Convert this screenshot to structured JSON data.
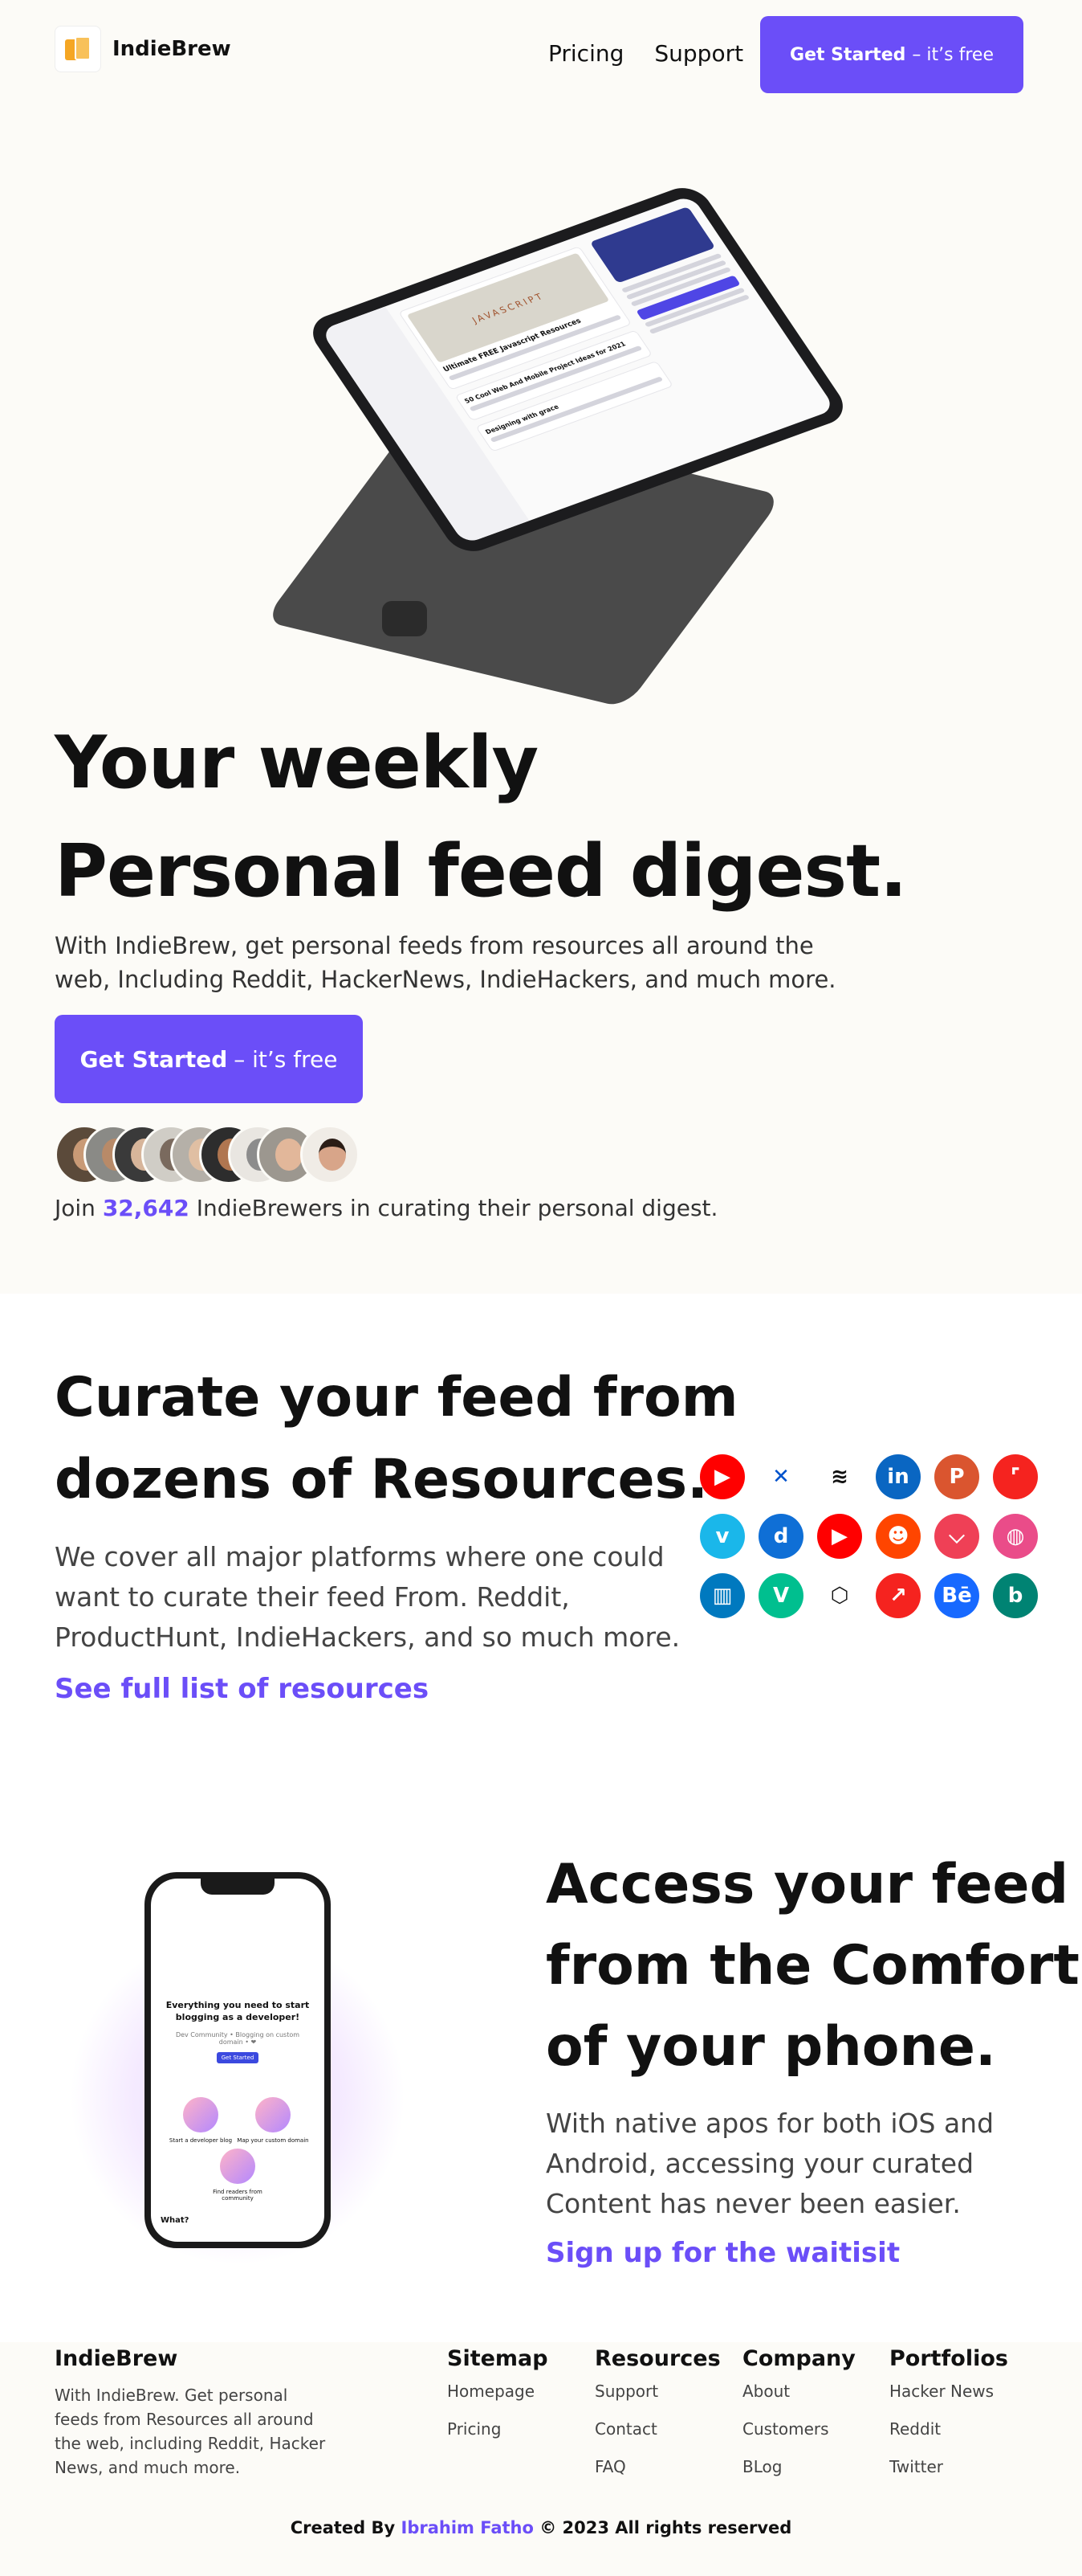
{
  "brand": {
    "name": "IndieBrew"
  },
  "nav": {
    "links": [
      "Pricing",
      "Support"
    ],
    "cta_bold": "Get Started",
    "cta_rest": "– it’s free"
  },
  "hero": {
    "title_line1": "Your weekly",
    "title_line2": "Personal feed digest.",
    "subtitle": "With IndieBrew, get personal feeds from resources all around the web, Including Reddit, HackerNews, IndieHackers, and much more.",
    "cta_bold": "Get Started",
    "cta_rest": "– it’s free",
    "join_prefix": "Join ",
    "join_count": "32,642",
    "join_suffix": " IndieBrewers in curating their personal digest.",
    "tablet_screen": {
      "post_1": "Ultimate FREE Javascript Resources",
      "post_2": "50 Cool Web And Mobile Project Ideas for 2021",
      "post_3": "Designing with grace",
      "cover_text": "JAVASCRIPT"
    }
  },
  "curate": {
    "title_line1": "Curate your feed from",
    "title_line2": "dozens of Resources.",
    "description": "We cover all major platforms where one could want to curate their feed From. Reddit, ProductHunt, IndieHackers, and so much more.",
    "link": "See full list of resources",
    "resources": [
      {
        "name": "youtube-icon",
        "color": "#ff0000",
        "glyph": "▶"
      },
      {
        "name": "confluence-icon",
        "color": "#ffffff",
        "glyph": "✕"
      },
      {
        "name": "buffer-icon",
        "color": "#ffffff",
        "glyph": "≋"
      },
      {
        "name": "linkedin-icon",
        "color": "#0a66c2",
        "glyph": "in"
      },
      {
        "name": "producthunt-icon",
        "color": "#da552f",
        "glyph": "P"
      },
      {
        "name": "screenshot-icon",
        "color": "#f5231f",
        "glyph": "⌜"
      },
      {
        "name": "vimeo-icon",
        "color": "#1ab7ea",
        "glyph": "v"
      },
      {
        "name": "dailydev-icon",
        "color": "#0f6fd6",
        "glyph": "d"
      },
      {
        "name": "youtube-icon-2",
        "color": "#ff0000",
        "glyph": "▶"
      },
      {
        "name": "reddit-icon",
        "color": "#ff4500",
        "glyph": "☻"
      },
      {
        "name": "pocket-icon",
        "color": "#ef4056",
        "glyph": "⌵"
      },
      {
        "name": "dribbble-icon",
        "color": "#ea4c89",
        "glyph": "◍"
      },
      {
        "name": "trello-icon",
        "color": "#0079bf",
        "glyph": "▥"
      },
      {
        "name": "vine-icon",
        "color": "#00bf8f",
        "glyph": "V"
      },
      {
        "name": "codepen-icon",
        "color": "#ffffff",
        "glyph": "⬡"
      },
      {
        "name": "trending-icon",
        "color": "#f5231f",
        "glyph": "↗"
      },
      {
        "name": "behance-icon",
        "color": "#1769ff",
        "glyph": "Bē"
      },
      {
        "name": "bing-icon",
        "color": "#008373",
        "glyph": "b"
      }
    ]
  },
  "access": {
    "title_line1": "Access your feed",
    "title_line2": "from the Comfort",
    "title_line3": "of your phone.",
    "description": "With native apos for both iOS and Android, accessing your curated Content has never been easier.",
    "link": "Sign up for the waitisit",
    "phone_screen": {
      "heading": "Everything you need to start blogging as a developer!",
      "sub": "Dev Community • Blogging on custom domain • ❤",
      "button": "Get Started",
      "feature_1": "Start a developer blog",
      "feature_2": "Map your custom domain",
      "feature_3": "Find readers from community",
      "footer": "What?"
    }
  },
  "footer": {
    "brand": "IndieBrew",
    "description": "With IndieBrew. Get personal feeds from Resources all around the web, including Reddit, Hacker News, and much more.",
    "columns": [
      {
        "title": "Sitemap",
        "items": [
          "Homepage",
          "Pricing"
        ]
      },
      {
        "title": "Resources",
        "items": [
          "Support",
          "Contact",
          "FAQ"
        ]
      },
      {
        "title": "Company",
        "items": [
          "About",
          "Customers",
          "BLog"
        ]
      },
      {
        "title": "Portfolios",
        "items": [
          "Hacker News",
          "Reddit",
          "Twitter"
        ]
      }
    ],
    "copyright_prefix": "Created By ",
    "copyright_author": "Ibrahim Fatho",
    "copyright_suffix": " © 2023 All rights reserved"
  },
  "colors": {
    "accent": "#6b4ef8",
    "hero_bg": "#fcfbf7",
    "text": "#111111"
  }
}
